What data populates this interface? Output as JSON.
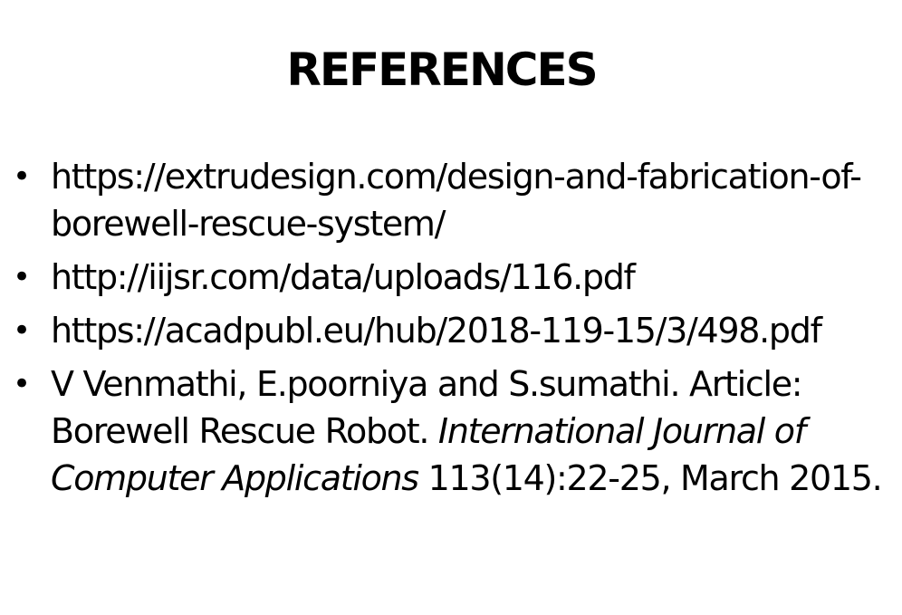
{
  "slide": {
    "title": "REFERENCES",
    "bullet_glyph": "•",
    "references": [
      {
        "text": "https://extrudesign.com/design-and-fabrication-of-borewell-rescue-system/"
      },
      {
        "text": "http://iijsr.com/data/uploads/116.pdf"
      },
      {
        "text": "https://acadpubl.eu/hub/2018-119-15/3/498.pdf"
      },
      {
        "authors": "V Venmathi, E.poorniya and S.sumathi. Article: Borewell Rescue Robot.",
        "journal": "International Journal of Computer Applications",
        "details": "113(14):22-25, March 2015."
      }
    ]
  }
}
